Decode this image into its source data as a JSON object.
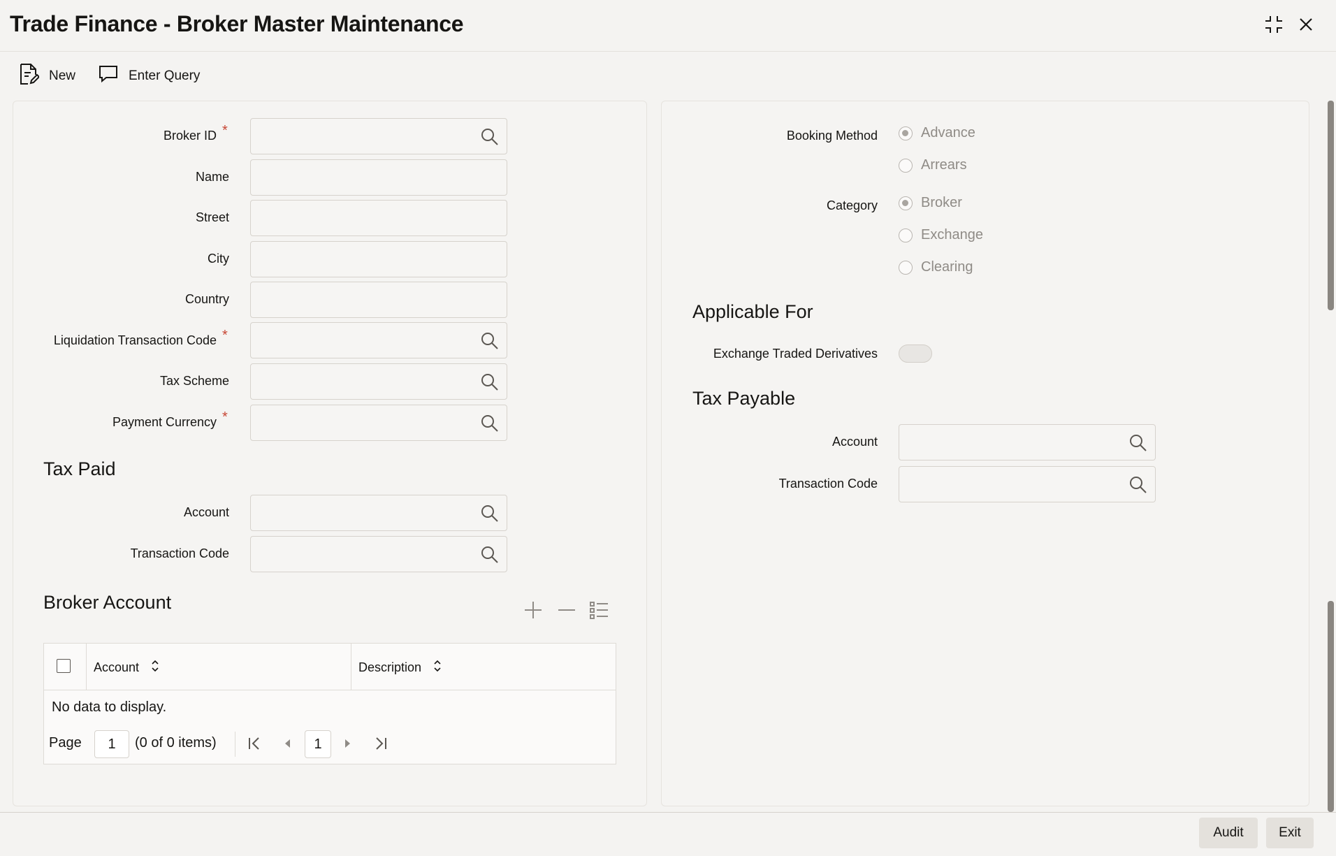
{
  "window": {
    "title": "Trade Finance - Broker Master Maintenance",
    "maximize_icon": "compress-icon",
    "close_icon": "close-icon"
  },
  "toolbar": {
    "new_label": "New",
    "enter_query_label": "Enter Query"
  },
  "left_panel": {
    "broker_id_label": "Broker ID",
    "name_label": "Name",
    "street_label": "Street",
    "city_label": "City",
    "country_label": "Country",
    "liquidation_code_label": "Liquidation Transaction Code",
    "tax_scheme_label": "Tax Scheme",
    "payment_currency_label": "Payment Currency",
    "required_marker": "*",
    "tax_paid": {
      "title": "Tax Paid",
      "account_label": "Account",
      "transaction_code_label": "Transaction Code"
    },
    "broker_account": {
      "title": "Broker Account",
      "columns": [
        "Account",
        "Description"
      ],
      "empty_text": "No data to display.",
      "page_label": "Page",
      "page_value": "1",
      "items_text": "(0 of 0 items)",
      "current_page": "1"
    }
  },
  "right_panel": {
    "booking_method_label": "Booking Method",
    "booking_options": [
      "Advance",
      "Arrears"
    ],
    "booking_selected": "Advance",
    "category_label": "Category",
    "category_options": [
      "Broker",
      "Exchange",
      "Clearing"
    ],
    "category_selected": "Broker",
    "applicable_for_title": "Applicable For",
    "exchange_traded_label": "Exchange Traded Derivatives",
    "exchange_traded_on": false,
    "tax_payable": {
      "title": "Tax Payable",
      "account_label": "Account",
      "transaction_code_label": "Transaction Code"
    }
  },
  "footer": {
    "audit_label": "Audit",
    "exit_label": "Exit"
  },
  "colors": {
    "required": "#c74634",
    "background": "#f4f3f1"
  }
}
